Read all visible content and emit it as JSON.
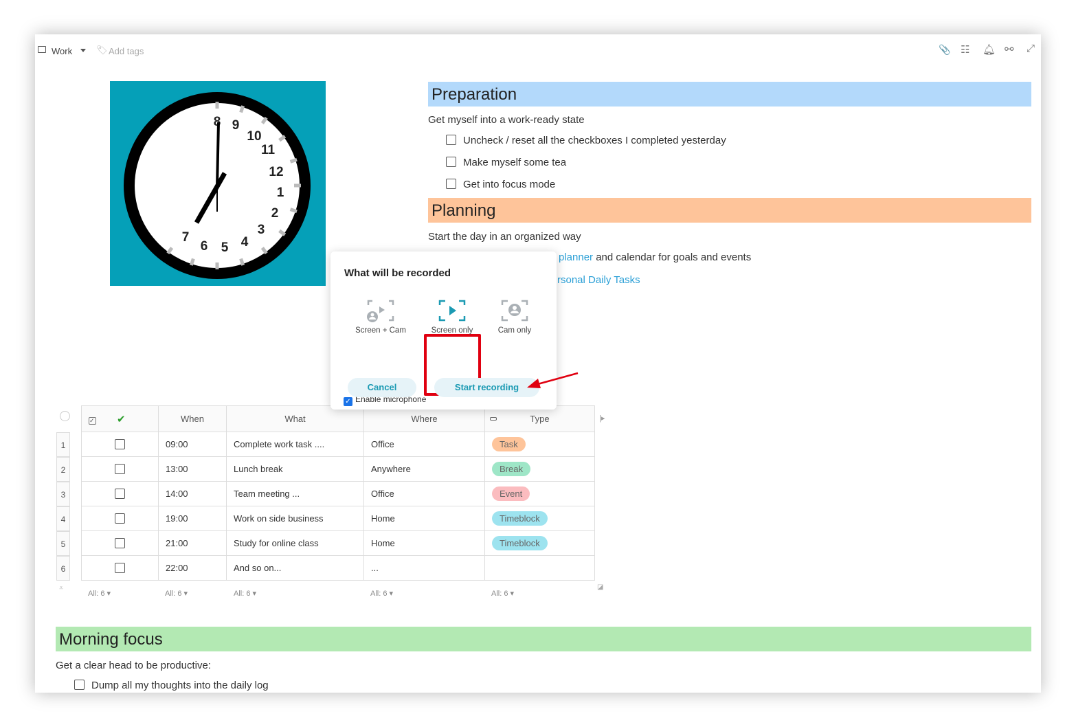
{
  "topbar": {
    "folder": "Work",
    "add_tags": "Add tags",
    "icons": [
      "paperclip-icon",
      "layout-icon",
      "bell-icon",
      "share-icon",
      "expand-icon"
    ]
  },
  "clock": {
    "numerals": [
      "8",
      "9",
      "10",
      "11",
      "12",
      "1",
      "2",
      "3",
      "4",
      "5",
      "6",
      "7"
    ],
    "background": "#05a0b8"
  },
  "preparation": {
    "title": "Preparation",
    "color": "#b3d9fb",
    "subtitle": "Get myself into a work-ready state",
    "items": [
      "Uncheck / reset all the checkboxes I completed yesterday",
      "Make myself some tea",
      "Get into focus mode"
    ]
  },
  "planning": {
    "title": "Planning",
    "color": "#fec49a",
    "subtitle": "Start the day in an organized way",
    "line1_link": "planner",
    "line1_rest": " and calendar for goals and events",
    "line2_link": "rsonal Daily Tasks"
  },
  "dialog": {
    "title": "What will be recorded",
    "options": [
      {
        "label": "Screen + Cam",
        "selected": false
      },
      {
        "label": "Screen only",
        "selected": true
      },
      {
        "label": "Cam only",
        "selected": false
      }
    ],
    "microphone_label": "Enable microphone",
    "microphone_checked": true,
    "cancel": "Cancel",
    "start": "Start recording"
  },
  "table": {
    "headers": [
      "When",
      "What",
      "Where",
      "Type"
    ],
    "rows": [
      {
        "n": "1",
        "when": "09:00",
        "what": "Complete work task ....",
        "where": "Office",
        "type": "Task",
        "type_color": "#fec49a"
      },
      {
        "n": "2",
        "when": "13:00",
        "what": "Lunch break",
        "where": "Anywhere",
        "type": "Break",
        "type_color": "#9ee6c7"
      },
      {
        "n": "3",
        "when": "14:00",
        "what": "Team meeting ...",
        "where": "Office",
        "type": "Event",
        "type_color": "#fbbcbf"
      },
      {
        "n": "4",
        "when": "19:00",
        "what": "Work on side business",
        "where": "Home",
        "type": "Timeblock",
        "type_color": "#9de3ef"
      },
      {
        "n": "5",
        "when": "21:00",
        "what": "Study for online class",
        "where": "Home",
        "type": "Timeblock",
        "type_color": "#9de3ef"
      },
      {
        "n": "6",
        "when": "22:00",
        "what": "And so on...",
        "where": "...",
        "type": "",
        "type_color": ""
      }
    ],
    "footer": "All: 6"
  },
  "morning": {
    "title": "Morning focus",
    "color": "#b3e9b3",
    "subtitle": "Get a clear head to be productive:",
    "items": [
      "Dump all my thoughts into the daily log"
    ]
  }
}
